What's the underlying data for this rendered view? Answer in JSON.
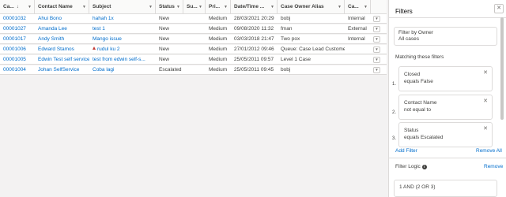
{
  "table": {
    "columns": [
      {
        "label": "Ca...",
        "sort": "↓"
      },
      {
        "label": "Contact Name"
      },
      {
        "label": "Subject"
      },
      {
        "label": "Status"
      },
      {
        "label": "Su..."
      },
      {
        "label": "Pri..."
      },
      {
        "label": "Date/Time ..."
      },
      {
        "label": "Case Owner Alias"
      },
      {
        "label": "Ca..."
      }
    ],
    "rows": [
      {
        "case": "00001032",
        "contact": "Ahui Bono",
        "subject": "hahah 1x",
        "status": "New",
        "priority": "Medium",
        "date": "28/03/2021 20:29",
        "owner": "bobj",
        "type": "Internal",
        "flag": false
      },
      {
        "case": "00001027",
        "contact": "Amanda Lee",
        "subject": "test 1",
        "status": "New",
        "priority": "Medium",
        "date": "09/08/2020 11:32",
        "owner": "fman",
        "type": "External",
        "flag": false
      },
      {
        "case": "00001017",
        "contact": "Andy Smith",
        "subject": "Mango issue",
        "status": "New",
        "priority": "Medium",
        "date": "03/03/2018 21:47",
        "owner": "Two pox",
        "type": "Internal",
        "flag": false
      },
      {
        "case": "00001006",
        "contact": "Edward Stamos",
        "subject": "rudul ku 2",
        "status": "New",
        "priority": "Medium",
        "date": "27/01/2012 09:46",
        "owner": "Queue: Case Lead Customer",
        "type": "",
        "flag": true
      },
      {
        "case": "00001005",
        "contact": "Edwin Test self service",
        "subject": "test from edwin self-s...",
        "status": "New",
        "priority": "Medium",
        "date": "25/05/2011 09:57",
        "owner": "Level 1 Case",
        "type": "",
        "flag": false
      },
      {
        "case": "00001004",
        "contact": "Johan SelfService",
        "subject": "Coba lagi",
        "status": "Escalated",
        "priority": "Medium",
        "date": "25/05/2011 09:45",
        "owner": "bobj",
        "type": "",
        "flag": false
      }
    ],
    "row_action_icon": "chevron-down-icon"
  },
  "filters": {
    "title": "Filters",
    "close_icon": "close-icon",
    "owner": {
      "label": "Filter by Owner",
      "value": "All cases"
    },
    "matching_label": "Matching these filters",
    "items": [
      {
        "num": "1.",
        "field": "Closed",
        "expr": "equals False"
      },
      {
        "num": "2.",
        "field": "Contact Name",
        "expr": "not equal to"
      },
      {
        "num": "3.",
        "field": "Status",
        "expr": "equals Escalated"
      }
    ],
    "add_filter": "Add Filter",
    "remove_all": "Remove All",
    "logic_label": "Filter Logic",
    "logic_remove": "Remove",
    "logic_value": "1 AND (2 OR 3)"
  }
}
